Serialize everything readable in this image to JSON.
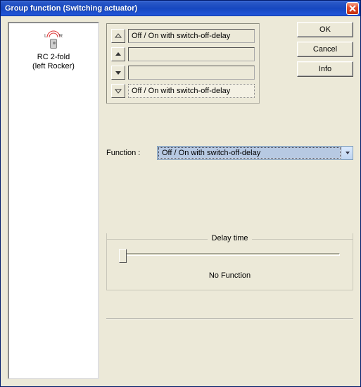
{
  "window": {
    "title": "Group function (Switching actuator)"
  },
  "buttons": {
    "ok": "OK",
    "cancel": "Cancel",
    "info": "Info"
  },
  "device": {
    "name": "RC 2-fold",
    "sub": "(left Rocker)"
  },
  "rocker": {
    "rows": [
      {
        "dir": "up",
        "label": "Off / On with switch-off-delay",
        "selected": false
      },
      {
        "dir": "up",
        "label": "",
        "selected": false
      },
      {
        "dir": "down",
        "label": "",
        "selected": false
      },
      {
        "dir": "down",
        "label": "Off / On with switch-off-delay",
        "selected": true
      }
    ]
  },
  "function": {
    "label": "Function :",
    "value": "Off / On with switch-off-delay"
  },
  "delay": {
    "legend": "Delay time",
    "status": "No Function"
  }
}
